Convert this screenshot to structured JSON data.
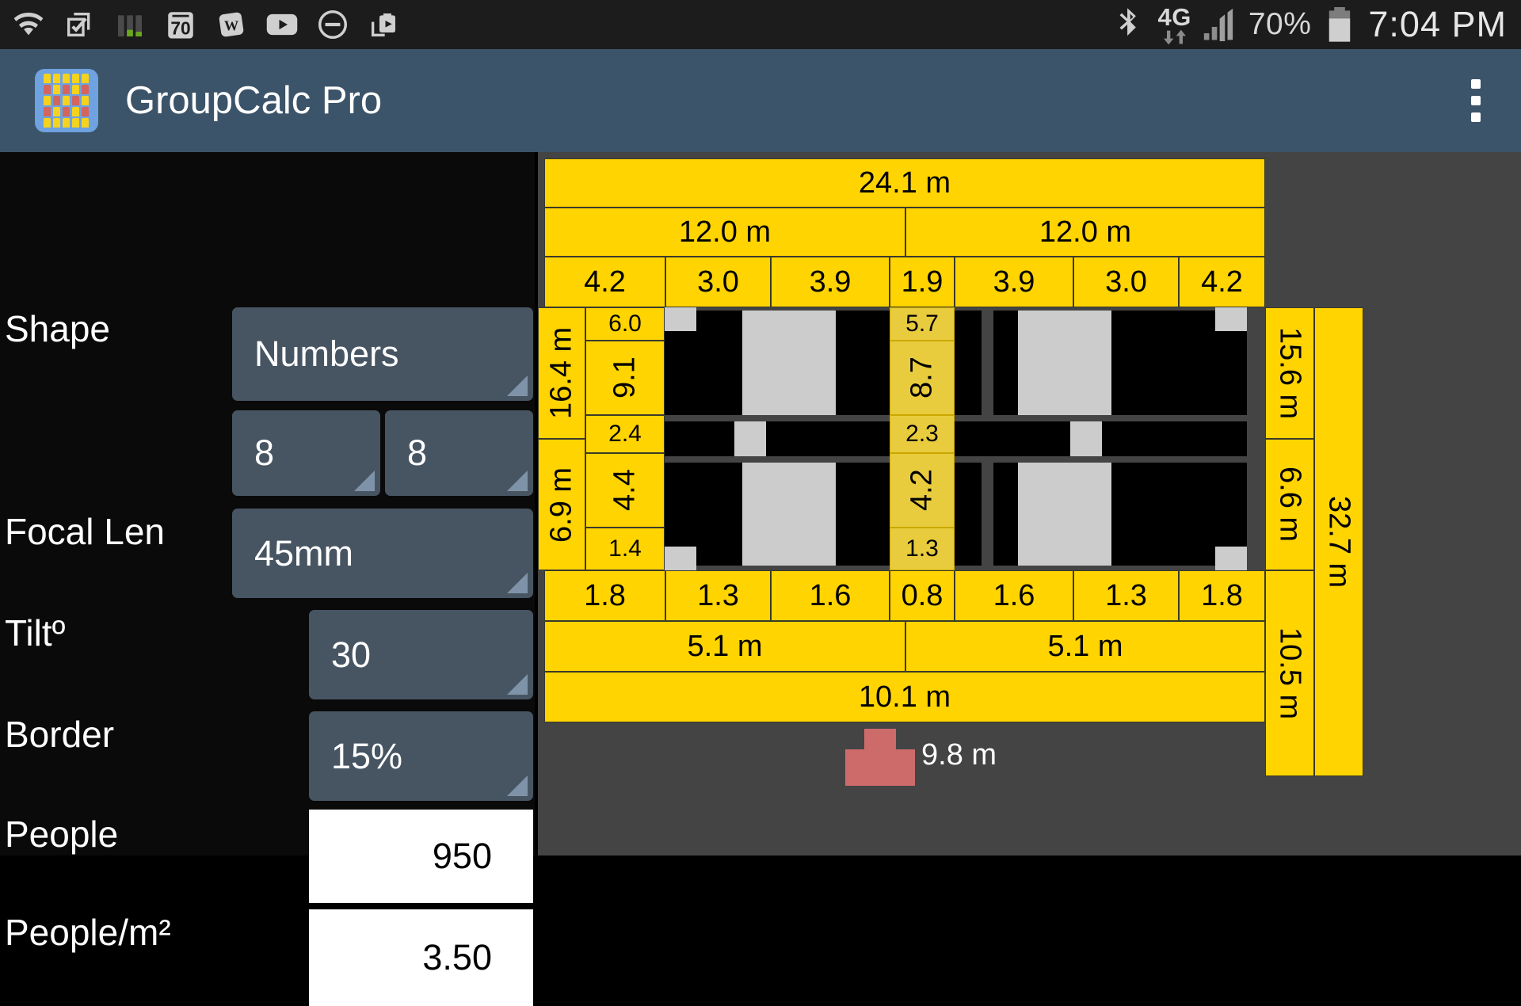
{
  "statusbar": {
    "left_icons": [
      "wifi-icon",
      "checkbox-note-icon",
      "bar-chart-icon",
      "speed-70-icon",
      "word-w-icon",
      "youtube-play-icon",
      "minus-circle-icon",
      "clipboard-share-icon"
    ],
    "speed_badge": "70",
    "word_badge": "W",
    "right": {
      "bluetooth_icon": "bluetooth-icon",
      "network_type": "4G",
      "data_arrows_icon": "data-transfer-arrows-icon",
      "signal_icon": "signal-bars-icon",
      "battery_percent": "70%",
      "battery_icon": "battery-icon",
      "clock": "7:04 PM"
    }
  },
  "actionbar": {
    "app_icon": "group-people-app-icon",
    "title": "GroupCalc Pro",
    "overflow_icon": "overflow-menu-icon"
  },
  "controls": {
    "shape_label": "Shape",
    "shape_value": "Numbers",
    "cols_value": "8",
    "rows_value": "8",
    "focal_label": "Focal Len",
    "focal_value": "45mm",
    "tilt_label": "Tiltº",
    "tilt_value": "30",
    "border_label": "Border",
    "border_value": "15%",
    "people_label": "People",
    "people_value": "950",
    "density_label": "People/m²",
    "density_value": "3.50"
  },
  "diagram": {
    "total_width": "24.1 m",
    "half_left": "12.0 m",
    "half_right": "12.0 m",
    "top_segments": [
      "4.2",
      "3.0",
      "3.9",
      "1.9",
      "3.9",
      "3.0",
      "4.2"
    ],
    "bottom_segments": [
      "1.8",
      "1.3",
      "1.6",
      "0.8",
      "1.6",
      "1.3",
      "1.8"
    ],
    "bottom_half_left": "5.1 m",
    "bottom_half_right": "5.1 m",
    "bottom_total": "10.1 m",
    "left_upper_total": "16.4 m",
    "left_lower_total": "6.9 m",
    "left_inner": [
      "6.0",
      "9.1",
      "2.4",
      "4.4",
      "1.4"
    ],
    "center_column": [
      "5.7",
      "8.7",
      "2.3",
      "4.2",
      "1.3"
    ],
    "right_upper": "15.6 m",
    "right_mid": "6.6 m",
    "right_lower": "10.5 m",
    "right_total": "32.7 m",
    "camera_distance": "9.8 m",
    "camera_marker": "camera-position-marker",
    "colors": {
      "yellow": "#ffd400",
      "yellow_dim": "#e8cc3d",
      "block": "#000000",
      "grey_block": "#cccccc",
      "camera": "#cd6b6b",
      "background": "#444444"
    }
  }
}
